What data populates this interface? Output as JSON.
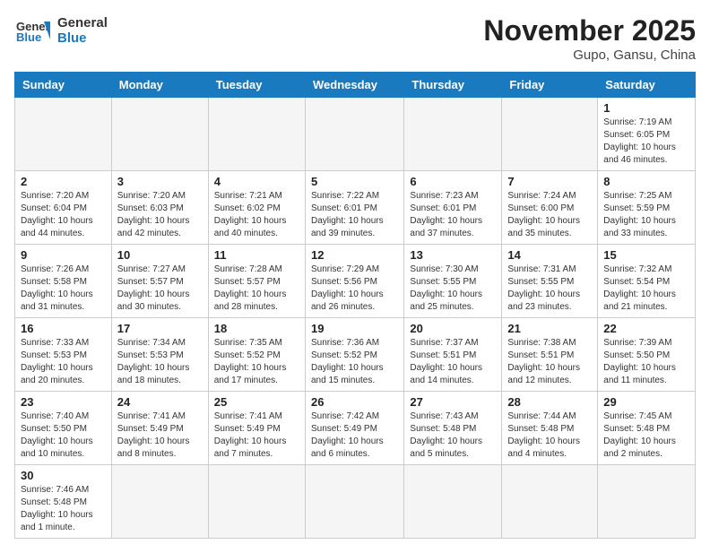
{
  "logo": {
    "line1": "General",
    "line2": "Blue"
  },
  "title": "November 2025",
  "location": "Gupo, Gansu, China",
  "days_of_week": [
    "Sunday",
    "Monday",
    "Tuesday",
    "Wednesday",
    "Thursday",
    "Friday",
    "Saturday"
  ],
  "weeks": [
    [
      {
        "day": "",
        "info": ""
      },
      {
        "day": "",
        "info": ""
      },
      {
        "day": "",
        "info": ""
      },
      {
        "day": "",
        "info": ""
      },
      {
        "day": "",
        "info": ""
      },
      {
        "day": "",
        "info": ""
      },
      {
        "day": "1",
        "info": "Sunrise: 7:19 AM\nSunset: 6:05 PM\nDaylight: 10 hours and 46 minutes."
      }
    ],
    [
      {
        "day": "2",
        "info": "Sunrise: 7:20 AM\nSunset: 6:04 PM\nDaylight: 10 hours and 44 minutes."
      },
      {
        "day": "3",
        "info": "Sunrise: 7:20 AM\nSunset: 6:03 PM\nDaylight: 10 hours and 42 minutes."
      },
      {
        "day": "4",
        "info": "Sunrise: 7:21 AM\nSunset: 6:02 PM\nDaylight: 10 hours and 40 minutes."
      },
      {
        "day": "5",
        "info": "Sunrise: 7:22 AM\nSunset: 6:01 PM\nDaylight: 10 hours and 39 minutes."
      },
      {
        "day": "6",
        "info": "Sunrise: 7:23 AM\nSunset: 6:01 PM\nDaylight: 10 hours and 37 minutes."
      },
      {
        "day": "7",
        "info": "Sunrise: 7:24 AM\nSunset: 6:00 PM\nDaylight: 10 hours and 35 minutes."
      },
      {
        "day": "8",
        "info": "Sunrise: 7:25 AM\nSunset: 5:59 PM\nDaylight: 10 hours and 33 minutes."
      }
    ],
    [
      {
        "day": "9",
        "info": "Sunrise: 7:26 AM\nSunset: 5:58 PM\nDaylight: 10 hours and 31 minutes."
      },
      {
        "day": "10",
        "info": "Sunrise: 7:27 AM\nSunset: 5:57 PM\nDaylight: 10 hours and 30 minutes."
      },
      {
        "day": "11",
        "info": "Sunrise: 7:28 AM\nSunset: 5:57 PM\nDaylight: 10 hours and 28 minutes."
      },
      {
        "day": "12",
        "info": "Sunrise: 7:29 AM\nSunset: 5:56 PM\nDaylight: 10 hours and 26 minutes."
      },
      {
        "day": "13",
        "info": "Sunrise: 7:30 AM\nSunset: 5:55 PM\nDaylight: 10 hours and 25 minutes."
      },
      {
        "day": "14",
        "info": "Sunrise: 7:31 AM\nSunset: 5:55 PM\nDaylight: 10 hours and 23 minutes."
      },
      {
        "day": "15",
        "info": "Sunrise: 7:32 AM\nSunset: 5:54 PM\nDaylight: 10 hours and 21 minutes."
      }
    ],
    [
      {
        "day": "16",
        "info": "Sunrise: 7:33 AM\nSunset: 5:53 PM\nDaylight: 10 hours and 20 minutes."
      },
      {
        "day": "17",
        "info": "Sunrise: 7:34 AM\nSunset: 5:53 PM\nDaylight: 10 hours and 18 minutes."
      },
      {
        "day": "18",
        "info": "Sunrise: 7:35 AM\nSunset: 5:52 PM\nDaylight: 10 hours and 17 minutes."
      },
      {
        "day": "19",
        "info": "Sunrise: 7:36 AM\nSunset: 5:52 PM\nDaylight: 10 hours and 15 minutes."
      },
      {
        "day": "20",
        "info": "Sunrise: 7:37 AM\nSunset: 5:51 PM\nDaylight: 10 hours and 14 minutes."
      },
      {
        "day": "21",
        "info": "Sunrise: 7:38 AM\nSunset: 5:51 PM\nDaylight: 10 hours and 12 minutes."
      },
      {
        "day": "22",
        "info": "Sunrise: 7:39 AM\nSunset: 5:50 PM\nDaylight: 10 hours and 11 minutes."
      }
    ],
    [
      {
        "day": "23",
        "info": "Sunrise: 7:40 AM\nSunset: 5:50 PM\nDaylight: 10 hours and 10 minutes."
      },
      {
        "day": "24",
        "info": "Sunrise: 7:41 AM\nSunset: 5:49 PM\nDaylight: 10 hours and 8 minutes."
      },
      {
        "day": "25",
        "info": "Sunrise: 7:41 AM\nSunset: 5:49 PM\nDaylight: 10 hours and 7 minutes."
      },
      {
        "day": "26",
        "info": "Sunrise: 7:42 AM\nSunset: 5:49 PM\nDaylight: 10 hours and 6 minutes."
      },
      {
        "day": "27",
        "info": "Sunrise: 7:43 AM\nSunset: 5:48 PM\nDaylight: 10 hours and 5 minutes."
      },
      {
        "day": "28",
        "info": "Sunrise: 7:44 AM\nSunset: 5:48 PM\nDaylight: 10 hours and 4 minutes."
      },
      {
        "day": "29",
        "info": "Sunrise: 7:45 AM\nSunset: 5:48 PM\nDaylight: 10 hours and 2 minutes."
      }
    ],
    [
      {
        "day": "30",
        "info": "Sunrise: 7:46 AM\nSunset: 5:48 PM\nDaylight: 10 hours and 1 minute."
      },
      {
        "day": "",
        "info": ""
      },
      {
        "day": "",
        "info": ""
      },
      {
        "day": "",
        "info": ""
      },
      {
        "day": "",
        "info": ""
      },
      {
        "day": "",
        "info": ""
      },
      {
        "day": "",
        "info": ""
      }
    ]
  ]
}
